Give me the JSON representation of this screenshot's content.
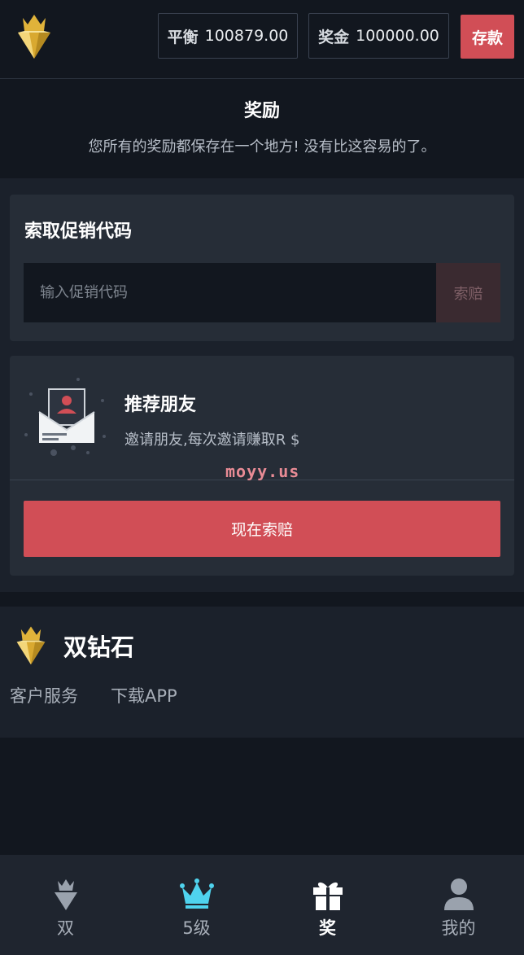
{
  "header": {
    "balance_label": "平衡",
    "balance_value": "100879.00",
    "bonus_label": "奖金",
    "bonus_value": "100000.00",
    "deposit_label": "存款"
  },
  "rewards": {
    "title": "奖励",
    "subtitle": "您所有的奖励都保存在一个地方! 没有比这容易的了。"
  },
  "promo": {
    "title": "索取促销代码",
    "placeholder": "输入促销代码",
    "claim_label": "索赔"
  },
  "referral": {
    "title": "推荐朋友",
    "description": "邀请朋友,每次邀请赚取R $",
    "watermark": "moyy.us",
    "claim_now_label": "现在索赔"
  },
  "footer": {
    "brand": "双钻石",
    "links": [
      "客户服务",
      "下载APP"
    ]
  },
  "nav": {
    "items": [
      {
        "label": "双",
        "icon": "diamond-icon"
      },
      {
        "label": "5级",
        "icon": "crown-icon"
      },
      {
        "label": "奖",
        "icon": "gift-icon",
        "active": true
      },
      {
        "label": "我的",
        "icon": "user-icon"
      }
    ]
  },
  "colors": {
    "accent": "#d14e56",
    "background": "#12171f",
    "card": "#262d37",
    "crown_cyan": "#4fd3ee",
    "gold": "#e5b83c"
  }
}
